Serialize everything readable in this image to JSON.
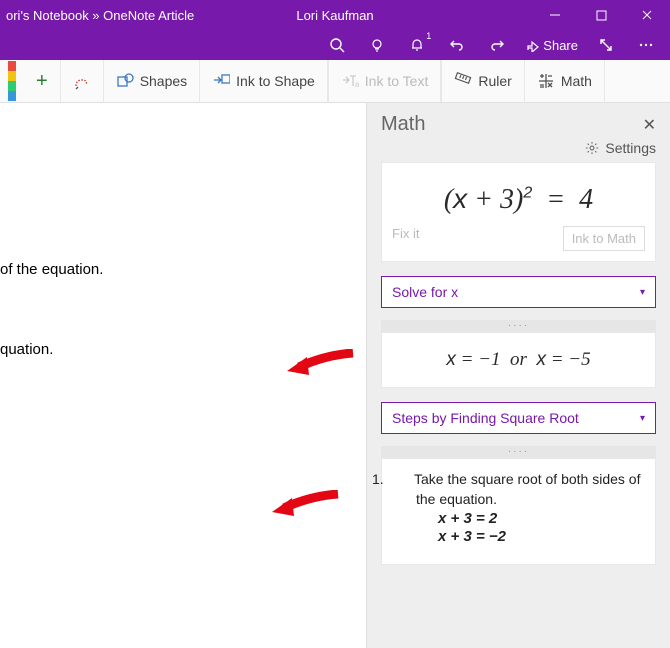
{
  "titlebar": {
    "breadcrumb": "ori's Notebook » OneNote Article",
    "user": "Lori Kaufman"
  },
  "cmdbar": {
    "notif_count": "1",
    "share_label": "Share"
  },
  "ribbon": {
    "shapes": "Shapes",
    "ink_to_shape": "Ink to Shape",
    "ink_to_text": "Ink to Text",
    "ruler": "Ruler",
    "math": "Math"
  },
  "canvas": {
    "frag1": "of the equation.",
    "frag2": "quation."
  },
  "mathpane": {
    "title": "Math",
    "settings": "Settings",
    "equation_display": "(x + 3)² = 4",
    "fix_it": "Fix it",
    "ink_to_math": "Ink to Math",
    "action_select": "Solve for x",
    "solution_display": "x = −1 or x = −5",
    "steps_select": "Steps by Finding Square Root",
    "step1_num": "1.",
    "step1_text": "Take the square root of both sides of the equation.",
    "step1_eq1": "x + 3 = 2",
    "step1_eq2": "x + 3 = −2"
  }
}
